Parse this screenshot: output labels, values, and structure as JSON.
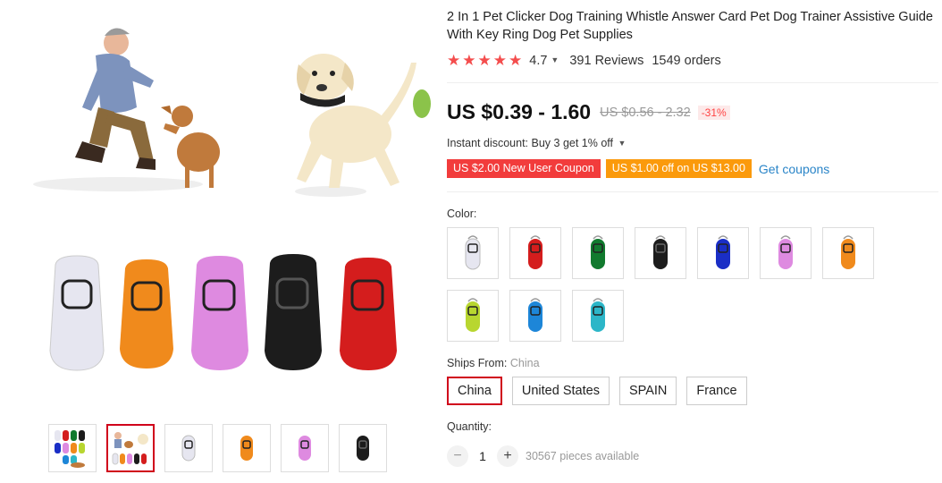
{
  "product": {
    "title": "2 In 1 Pet Clicker Dog Training Whistle Answer Card Pet Dog Trainer Assistive Guide With Key Ring Dog Pet Supplies",
    "rating": "4.7",
    "stars": 5,
    "reviews": "391 Reviews",
    "orders": "1549 orders"
  },
  "price": {
    "current": "US $0.39 - 1.60",
    "original": "US $0.56 - 2.32",
    "discount": "-31%"
  },
  "promo": {
    "instant_discount": "Instant discount: Buy 3 get 1% off",
    "coupon_new_user": "US $2.00 New User Coupon",
    "coupon_order": "US $1.00 off on US $13.00",
    "get_coupons": "Get coupons"
  },
  "color": {
    "label": "Color:",
    "options": [
      "white",
      "red",
      "green",
      "black",
      "blue",
      "pink",
      "orange",
      "yellow",
      "sky-blue",
      "cyan"
    ],
    "colors": {
      "white": "#e6e6f0",
      "red": "#d41d1d",
      "green": "#117a2e",
      "black": "#1c1c1c",
      "blue": "#1a2ec6",
      "pink": "#de8ae0",
      "orange": "#f08a1c",
      "yellow": "#b8d630",
      "sky-blue": "#1d86d8",
      "cyan": "#2cb6c8"
    }
  },
  "shipping": {
    "label": "Ships From:",
    "value": "China",
    "options": [
      "China",
      "United States",
      "SPAIN",
      "France"
    ],
    "selected": "China"
  },
  "quantity": {
    "label": "Quantity:",
    "value": "1",
    "available": "30567 pieces available"
  },
  "colors": {
    "accent_red": "#d0011b",
    "star_red": "#f44d4d",
    "link_blue": "#2a85c8",
    "coupon_red": "#f23c3c",
    "coupon_orange": "#fb9a0c"
  }
}
